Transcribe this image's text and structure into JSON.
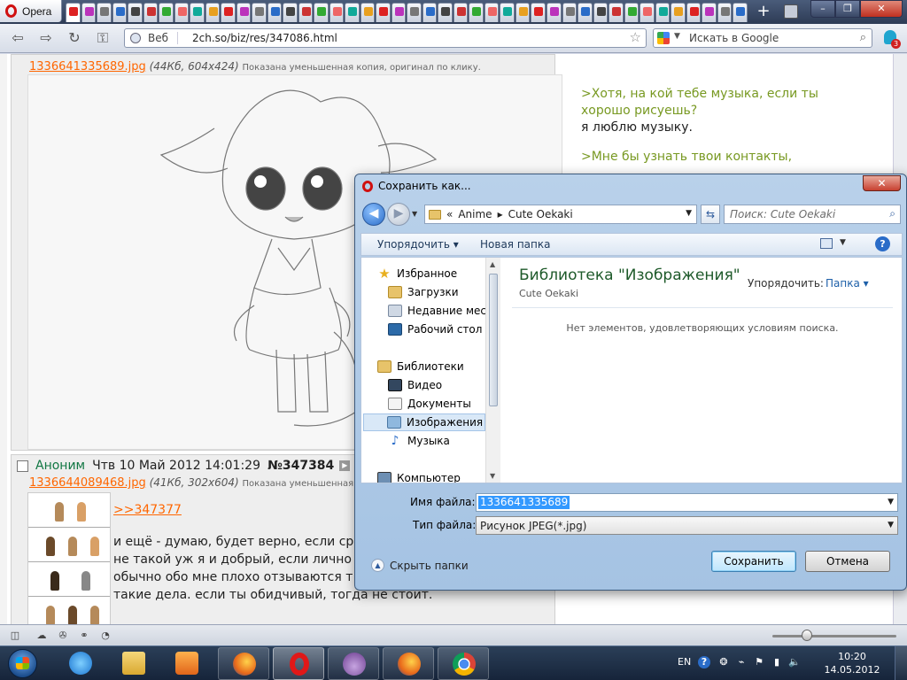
{
  "browser": {
    "menu_label": "Opera",
    "tab_count": 44,
    "new_tab_symbol": "+",
    "window_controls": {
      "minimize": "–",
      "maximize": "❐",
      "close": "✕"
    },
    "address": {
      "prefix": "Веб",
      "url": "2ch.so/biz/res/347086.html"
    },
    "search": {
      "engine_icon": "google-g-icon",
      "placeholder": "Искать в Google"
    },
    "unite_badge": "3"
  },
  "page": {
    "post1": {
      "file_name": "1336641335689.jpg",
      "file_info": "(44Кб, 604x424)",
      "file_hint": "Показана уменьшенная копия, оригинал по клику."
    },
    "side_reply": {
      "quote1_line1": ">Хотя, на кой тебе музыка, если ты",
      "quote1_line2": "хорошо рисуешь?",
      "answer1": "я люблю музыку.",
      "quote2": ">Мне бы узнать твои контакты,"
    },
    "post2": {
      "name": "Аноним",
      "date": "Чтв 10 Май 2012 14:01:29",
      "number": "№347384",
      "file_name": "1336644089468.jpg",
      "file_info": "(41Кб, 302x604)",
      "file_hint": "Показана уменьшенная",
      "reply_link": ">>347377",
      "text_line1": "и ещё - думаю, будет верно, если ср",
      "text_line2": "не такой уж я и добрый, если лично",
      "text_line3": "обычно обо мне плохо отзываются т",
      "text_line4": "такие дела. если ты обидчивый, тогда не стоит."
    }
  },
  "dialog": {
    "title": "Сохранить как...",
    "close_symbol": "✕",
    "breadcrumb": {
      "root": "«",
      "part1": "Anime",
      "sep": "▸",
      "part2": "Cute Oekaki"
    },
    "search_placeholder": "Поиск: Cute Oekaki",
    "toolbar": {
      "organize": "Упорядочить ▾",
      "new_folder": "Новая папка",
      "help": "?"
    },
    "nav": {
      "favorites": "Избранное",
      "downloads": "Загрузки",
      "recent": "Недавние места",
      "desktop": "Рабочий стол",
      "libraries": "Библиотеки",
      "video": "Видео",
      "documents": "Документы",
      "pictures": "Изображения",
      "music": "Музыка",
      "computer": "Компьютер"
    },
    "content": {
      "library_title": "Библиотека \"Изображения\"",
      "library_subtitle": "Cute Oekaki",
      "arrange_label": "Упорядочить:",
      "arrange_value": "Папка ▾",
      "empty_message": "Нет элементов, удовлетворяющих условиям поиска."
    },
    "fields": {
      "filename_label": "Имя файла:",
      "filename_value": "1336641335689",
      "filetype_label": "Тип файла:",
      "filetype_value": "Рисунок JPEG(*.jpg)"
    },
    "hide_folders": "Скрыть папки",
    "save_button": "Сохранить",
    "cancel_button": "Отмена"
  },
  "taskbar": {
    "language": "EN",
    "time": "10:20",
    "date": "14.05.2012"
  },
  "colors": {
    "link_orange": "#ff6600",
    "greentext": "#789922",
    "library_green": "#1e5a2a",
    "selection_blue": "#3399ff"
  }
}
